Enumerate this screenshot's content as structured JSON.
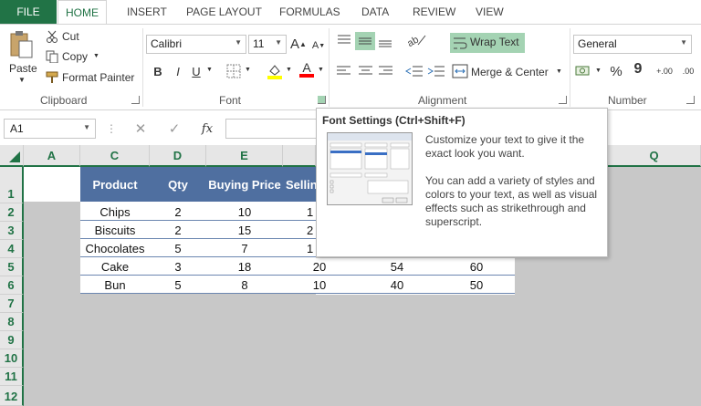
{
  "tabs": [
    "FILE",
    "HOME",
    "INSERT",
    "PAGE LAYOUT",
    "FORMULAS",
    "DATA",
    "REVIEW",
    "VIEW"
  ],
  "clipboard": {
    "paste": "Paste",
    "cut": "Cut",
    "copy": "Copy",
    "format_painter": "Format Painter",
    "label": "Clipboard"
  },
  "font": {
    "name": "Calibri",
    "size": "11",
    "label": "Font",
    "bold": "B",
    "italic": "I",
    "underline": "U",
    "grow": "A",
    "shrink": "A",
    "font_color_letter": "A"
  },
  "alignment": {
    "wrap_text": "Wrap Text",
    "merge_center": "Merge & Center",
    "label": "Alignment"
  },
  "number": {
    "format": "General",
    "percent": "%",
    "comma": "9",
    "inc_decimal": "+.00",
    "dec_decimal": ".00",
    "label": "Number"
  },
  "formula_bar": {
    "name_box": "A1",
    "fx": "fx"
  },
  "columns": [
    "A",
    "C",
    "D",
    "E",
    "Q"
  ],
  "rows": [
    "1",
    "2",
    "3",
    "4",
    "5",
    "6",
    "7",
    "8",
    "9",
    "10",
    "11",
    "12"
  ],
  "table": {
    "headers": [
      "Product",
      "Qty",
      "Buying Price",
      "Selling"
    ],
    "rows": [
      [
        "Chips",
        "2",
        "10",
        "",
        "",
        ""
      ],
      [
        "Biscuits",
        "2",
        "15",
        "",
        "",
        ""
      ],
      [
        "Chocolates",
        "5",
        "7",
        "",
        "",
        ""
      ],
      [
        "Cake",
        "3",
        "18",
        "20",
        "54",
        "60"
      ],
      [
        "Bun",
        "5",
        "8",
        "10",
        "40",
        "50"
      ]
    ],
    "partial_values": [
      "1",
      "2",
      "1"
    ]
  },
  "tooltip": {
    "title": "Font Settings (Ctrl+Shift+F)",
    "line1": "Customize your text to give it the exact look you want.",
    "line2": "You can add a variety of styles and colors to your text, as well as visual effects such as strikethrough and superscript."
  },
  "colors": {
    "accent": "#217346",
    "table_header": "#4f6fa0",
    "sheet_gray": "#c8c8c8"
  }
}
